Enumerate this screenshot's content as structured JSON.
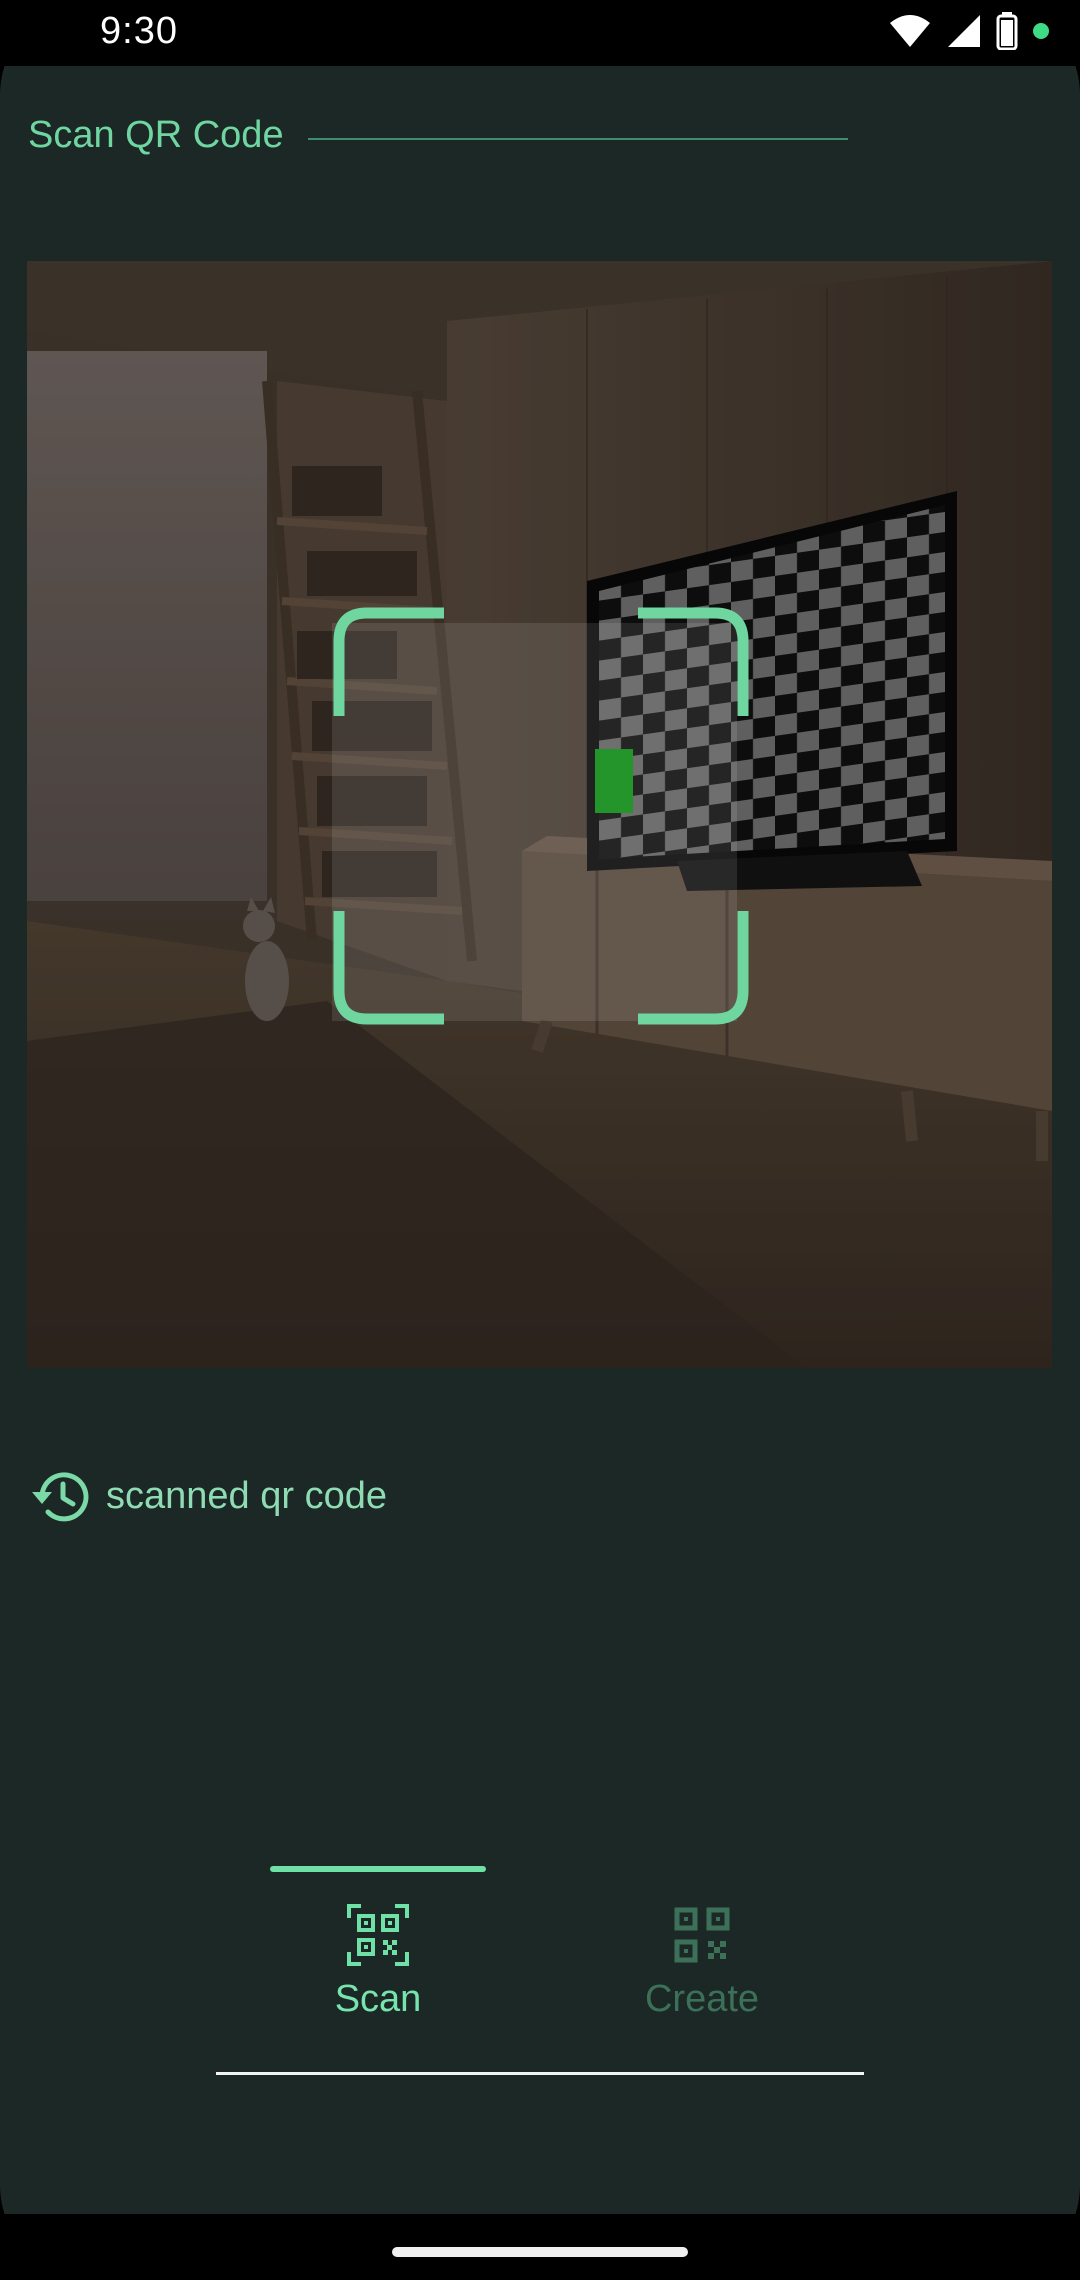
{
  "status_bar": {
    "time": "9:30"
  },
  "header": {
    "title": "Scan QR Code"
  },
  "history": {
    "label": "scanned qr code",
    "icon": "history-icon"
  },
  "tabs": [
    {
      "label": "Scan",
      "icon": "qr-scan-icon",
      "selected": true
    },
    {
      "label": "Create",
      "icon": "qr-code-icon",
      "selected": false
    }
  ],
  "colors": {
    "background": "#1b2826",
    "accent": "#6fe0a6",
    "title_text": "#6fd6a2",
    "inactive_tab": "#3c7058"
  }
}
